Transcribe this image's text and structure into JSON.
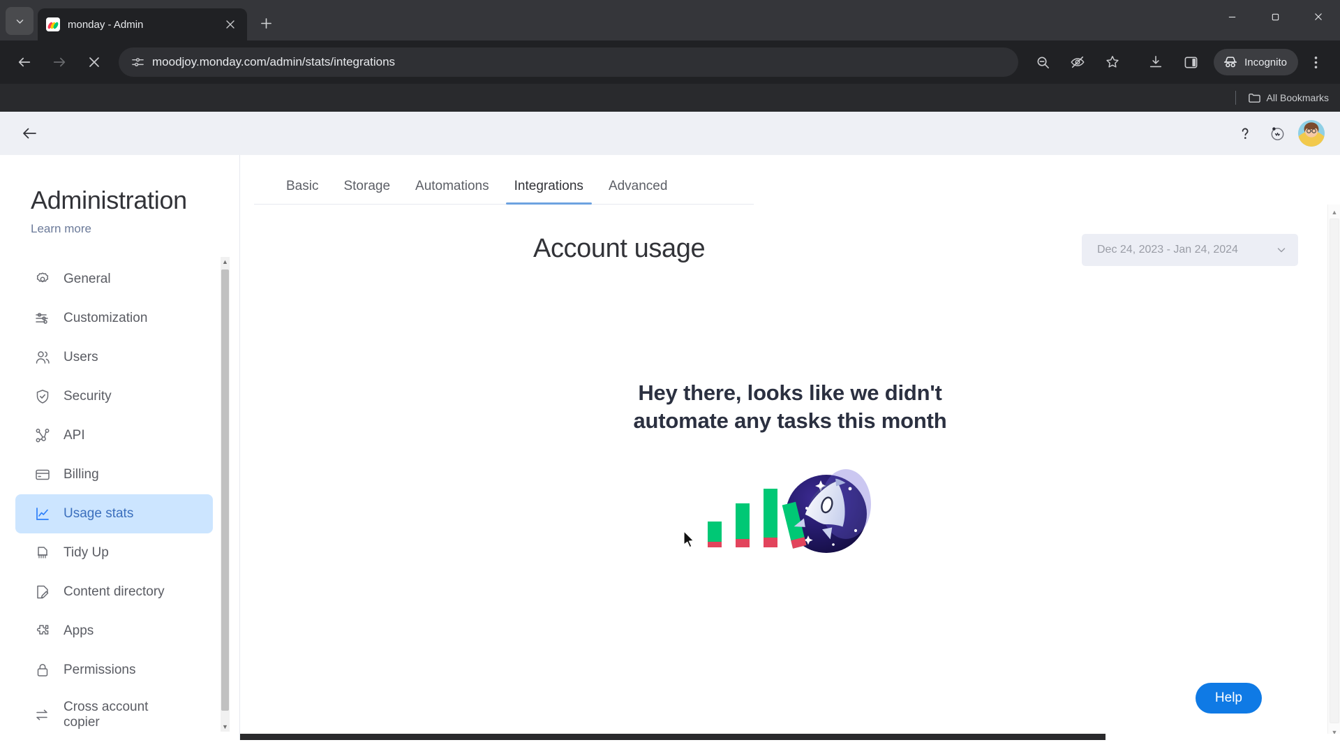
{
  "browser": {
    "tab": {
      "title": "monday - Admin",
      "close_icon": "close-icon",
      "favicon": "monday-logo-icon"
    },
    "tab_list_icon": "chevron-down-icon",
    "new_tab_icon": "plus-icon",
    "window_controls": {
      "minimize": "minimize-icon",
      "maximize": "maximize-icon",
      "close": "close-icon"
    },
    "nav": {
      "back_icon": "back-arrow-icon",
      "forward_icon": "forward-arrow-icon",
      "stop_icon": "stop-loading-icon",
      "site_info_icon": "site-settings-icon",
      "url": "moodjoy.monday.com/admin/stats/integrations"
    },
    "toolbar_icons": [
      "zoom-out-icon",
      "eye-slash-icon",
      "bookmark-star-icon",
      "download-icon",
      "side-panel-icon",
      "incognito-icon",
      "three-dot-menu-icon"
    ],
    "incognito_label": "Incognito",
    "bookmarks": {
      "folder_icon": "folder-icon",
      "label": "All Bookmarks"
    }
  },
  "app_header": {
    "back_icon": "back-arrow-icon",
    "help_icon": "question-mark-icon",
    "monitor_icon": "screen-record-icon",
    "avatar": "user-avatar"
  },
  "sidebar": {
    "title": "Administration",
    "learn_more": "Learn more",
    "items": [
      {
        "label": "General",
        "icon": "gear-icon",
        "active": false
      },
      {
        "label": "Customization",
        "icon": "sliders-icon",
        "active": false
      },
      {
        "label": "Users",
        "icon": "users-icon",
        "active": false
      },
      {
        "label": "Security",
        "icon": "shield-check-icon",
        "active": false
      },
      {
        "label": "API",
        "icon": "nodes-icon",
        "active": false
      },
      {
        "label": "Billing",
        "icon": "credit-card-icon",
        "active": false
      },
      {
        "label": "Usage stats",
        "icon": "line-chart-icon",
        "active": true
      },
      {
        "label": "Tidy Up",
        "icon": "broom-icon",
        "active": false
      },
      {
        "label": "Content directory",
        "icon": "document-edit-icon",
        "active": false
      },
      {
        "label": "Apps",
        "icon": "puzzle-icon",
        "active": false
      },
      {
        "label": "Permissions",
        "icon": "lock-icon",
        "active": false
      },
      {
        "label": "Cross account copier",
        "icon": "transfer-arrows-icon",
        "active": false
      }
    ],
    "scrollbar": {
      "up_icon": "caret-up-icon",
      "down_icon": "caret-down-icon"
    }
  },
  "main": {
    "tabs": [
      {
        "label": "Basic",
        "active": false
      },
      {
        "label": "Storage",
        "active": false
      },
      {
        "label": "Automations",
        "active": false
      },
      {
        "label": "Integrations",
        "active": true
      },
      {
        "label": "Advanced",
        "active": false
      }
    ],
    "page_title": "Account usage",
    "date_range": {
      "value": "Dec 24, 2023 - Jan 24, 2024",
      "chevron_icon": "chevron-down-icon"
    },
    "empty_state": {
      "line1": "Hey there, looks like we didn't",
      "line2": "automate any tasks this month",
      "illustration": "rocket-bar-chart-illustration"
    },
    "help_button": "Help",
    "scrollbar": {
      "up_icon": "caret-up-icon",
      "down_icon": "caret-down-icon"
    }
  },
  "colors": {
    "accent_blue": "#0f7ae5",
    "active_nav_bg": "#cce5ff",
    "active_tab_underline": "#6da2e0",
    "chrome_dark": "#202124",
    "illustration_green": "#00c875",
    "illustration_red": "#e2445c",
    "illustration_navy": "#20155e"
  }
}
